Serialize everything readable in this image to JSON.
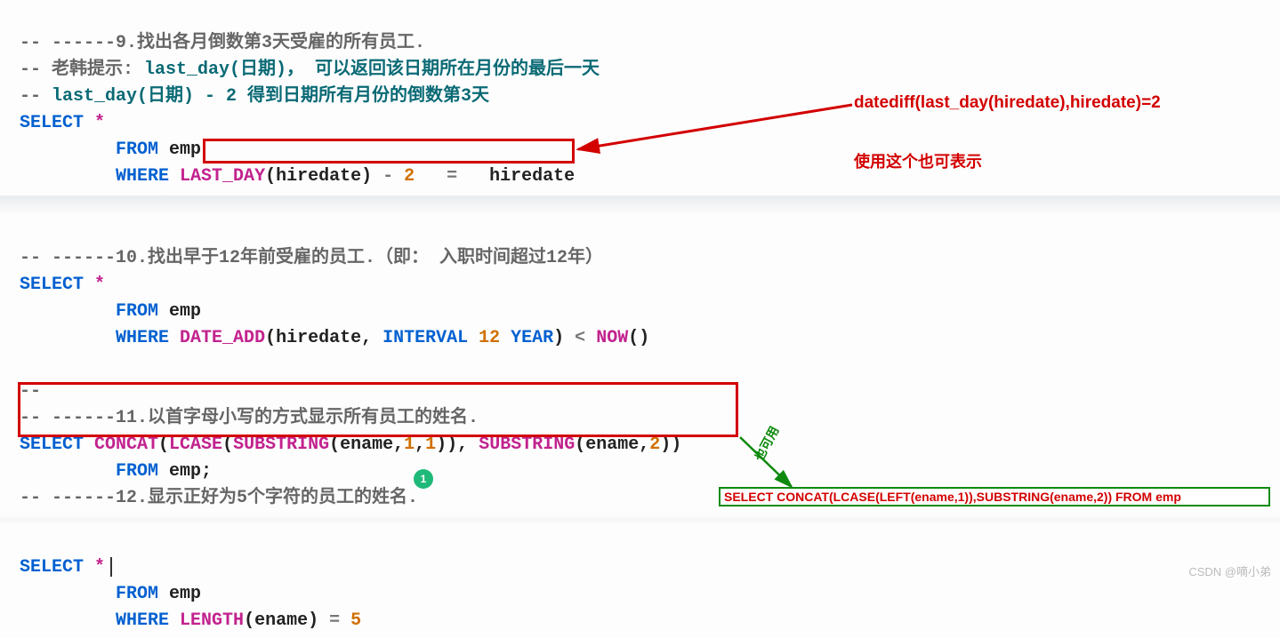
{
  "lines": {
    "c1": "-- ------9.找出各月倒数第3天受雇的所有员工.",
    "c2_a": "-- 老韩提示: ",
    "c2_b": "last_day(日期)， 可以返回该日期所在月份的最后一天",
    "c3_a": "-- ",
    "c3_b": "last_day(日期) - 2 得到日期所有月份的倒数第3天",
    "select": "SELECT",
    "star": " *",
    "from": "FROM",
    "emp": " emp",
    "where": "WHERE",
    "lastday": " LAST_DAY",
    "args9": "(hiredate) ",
    "minus": "- ",
    "two": "2",
    "eq": "   = ",
    "hiredate": "  hiredate",
    "c10": "-- ------10.找出早于12年前受雇的员工.（即： 入职时间超过12年）",
    "dateadd": " DATE_ADD",
    "args10a": "(hiredate, ",
    "interval": "INTERVAL",
    "twelve": " 12",
    "year": " YEAR",
    "close": ")",
    "lt": " < ",
    "now": "NOW",
    "nowp": "()",
    "dashdash": "--",
    "c11": "-- ------11.以首字母小写的方式显示所有员工的姓名.",
    "concat": " CONCAT",
    "lcase": "LCASE",
    "substring": "SUBSTRING",
    "sub_args1": "(ename,",
    "n1": "1",
    "comma": ",",
    "cp": ")), ",
    "sub_args2": "(ename,",
    "n2": "2",
    "cpp": "))",
    "emp_semi": " emp;",
    "c12": "-- ------12.显示正好为5个字符的员工的姓名.",
    "length": " LENGTH",
    "len_args": "(ename) ",
    "eq2": "= ",
    "five": "5"
  },
  "annotations": {
    "a1": "datediff(last_day(hiredate),hiredate)=2",
    "a2": "使用这个也可表示",
    "a3": "也可用",
    "greenbox": "SELECT CONCAT(LCASE(LEFT(ename,1)),SUBSTRING(ename,2)) FROM emp"
  },
  "watermark": "CSDN @嘀小弟",
  "green_dot": "1"
}
